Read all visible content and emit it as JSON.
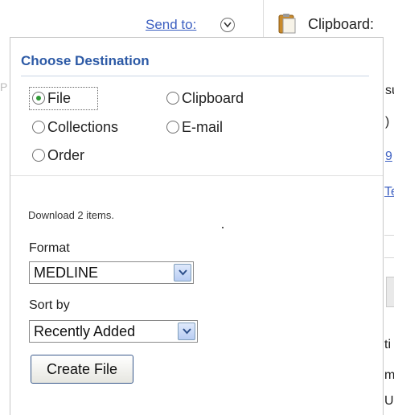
{
  "header": {
    "send_to_label": "Send to:",
    "send_to_dropdown_icon": "chevron-down-icon",
    "clipboard_icon": "clipboard-icon",
    "clipboard_label": "Clipboard:"
  },
  "popup": {
    "title": "Choose Destination",
    "destinations": [
      {
        "label": "File",
        "checked": true
      },
      {
        "label": "Clipboard",
        "checked": false
      },
      {
        "label": "Collections",
        "checked": false
      },
      {
        "label": "E-mail",
        "checked": false
      },
      {
        "label": "Order",
        "checked": false
      }
    ],
    "download_text": "Download 2 items.",
    "format": {
      "label": "Format",
      "value": "MEDLINE"
    },
    "sort_by": {
      "label": "Sort by",
      "value": "Recently Added"
    },
    "create_button_label": "Create File"
  },
  "background": {
    "left_fragment": "P",
    "right_fragments": [
      "su",
      ")",
      "9",
      "Te",
      "ti",
      "m",
      "U"
    ]
  },
  "colors": {
    "link": "#3c5fc1",
    "title": "#2d5aa6",
    "radio_selected": "#2f9a35"
  }
}
